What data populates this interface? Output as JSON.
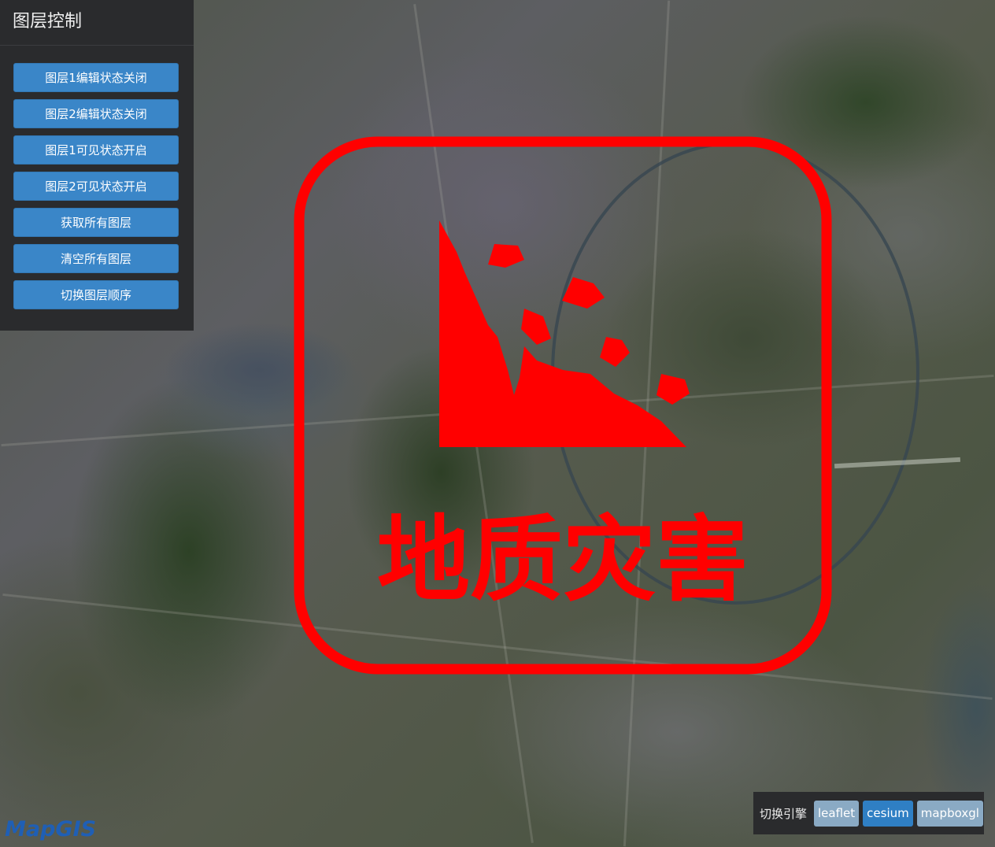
{
  "panel": {
    "title": "图层控制",
    "buttons": [
      {
        "label": "图层1编辑状态关闭"
      },
      {
        "label": "图层2编辑状态关闭"
      },
      {
        "label": "图层1可见状态开启"
      },
      {
        "label": "图层2可见状态开启"
      },
      {
        "label": "获取所有图层"
      },
      {
        "label": "清空所有图层"
      },
      {
        "label": "切换图层顺序"
      }
    ]
  },
  "logo": {
    "text": "地质灾害",
    "color": "#ff0000"
  },
  "engine_switcher": {
    "label": "切换引擎",
    "options": [
      {
        "label": "leaflet",
        "color": "#8aaac4"
      },
      {
        "label": "cesium",
        "color": "#2f7fc4"
      },
      {
        "label": "mapboxgl",
        "color": "#8aaac4"
      }
    ]
  },
  "watermark": {
    "text": "MapGIS",
    "color": "#1f5fb5"
  },
  "colors": {
    "panel_bg": "#2a2b2d",
    "button_blue": "#3a86c8"
  }
}
